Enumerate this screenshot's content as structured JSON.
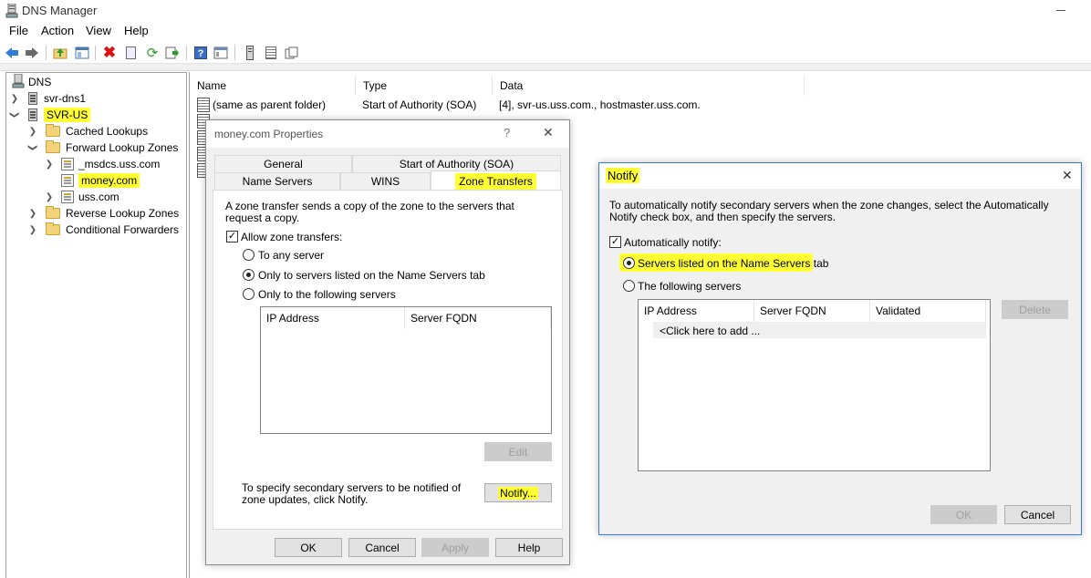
{
  "window": {
    "title": "DNS Manager"
  },
  "menu": [
    "File",
    "Action",
    "View",
    "Help"
  ],
  "toolbar": {
    "icons": [
      "back-arrow-icon",
      "forward-arrow-icon",
      "up-folder-icon",
      "show-hide-tree-icon",
      "delete-icon",
      "properties-icon",
      "refresh-icon",
      "export-list-icon",
      "help-icon",
      "console-icon",
      "server-icon",
      "list-icon",
      "copy-icon"
    ]
  },
  "tree": {
    "root": "DNS",
    "servers": [
      "svr-dns1",
      "SVR-US"
    ],
    "cached": "Cached Lookups",
    "forward": "Forward Lookup Zones",
    "zones": [
      "_msdcs.uss.com",
      "money.com",
      "uss.com"
    ],
    "reverse": "Reverse Lookup Zones",
    "conditional": "Conditional Forwarders"
  },
  "list": {
    "columns": [
      "Name",
      "Type",
      "Data"
    ],
    "rows": [
      {
        "name": "(same as parent folder)",
        "type": "Start of Authority (SOA)",
        "data": "[4], svr-us.uss.com., hostmaster.uss.com."
      }
    ]
  },
  "properties": {
    "title": "money.com Properties",
    "help_glyph": "?",
    "close_glyph": "✕",
    "tabs_back": [
      "General",
      "Start of Authority (SOA)"
    ],
    "tabs_front": [
      "Name Servers",
      "WINS",
      "Zone Transfers"
    ],
    "description": "A zone transfer sends a copy of the zone to the servers that request a copy.",
    "allow_label": "Allow zone transfers:",
    "allow_checked": true,
    "options": [
      "To any server",
      "Only to servers listed on the Name Servers tab",
      "Only to the following servers"
    ],
    "selected_option": 1,
    "server_columns": [
      "IP Address",
      "Server FQDN"
    ],
    "edit_label": "Edit",
    "notify_text": "To specify secondary servers to be notified of zone updates, click Notify.",
    "notify_label": "Notify...",
    "buttons": {
      "ok": "OK",
      "cancel": "Cancel",
      "apply": "Apply",
      "help": "Help"
    }
  },
  "notify": {
    "title": "Notify",
    "close_glyph": "✕",
    "description": "To automatically notify secondary servers when the zone changes, select the Automatically Notify check box, and then specify the servers.",
    "auto_label": "Automatically notify:",
    "auto_checked": true,
    "options": [
      "Servers listed on the Name Servers tab",
      "The following servers"
    ],
    "selected_option": 0,
    "columns": [
      "IP Address",
      "Server FQDN",
      "Validated"
    ],
    "add_row": "<Click here to add ...",
    "delete_label": "Delete",
    "buttons": {
      "ok": "OK",
      "cancel": "Cancel"
    }
  },
  "colors": {
    "highlight": "#ffff33",
    "accent": "#0078d7"
  }
}
